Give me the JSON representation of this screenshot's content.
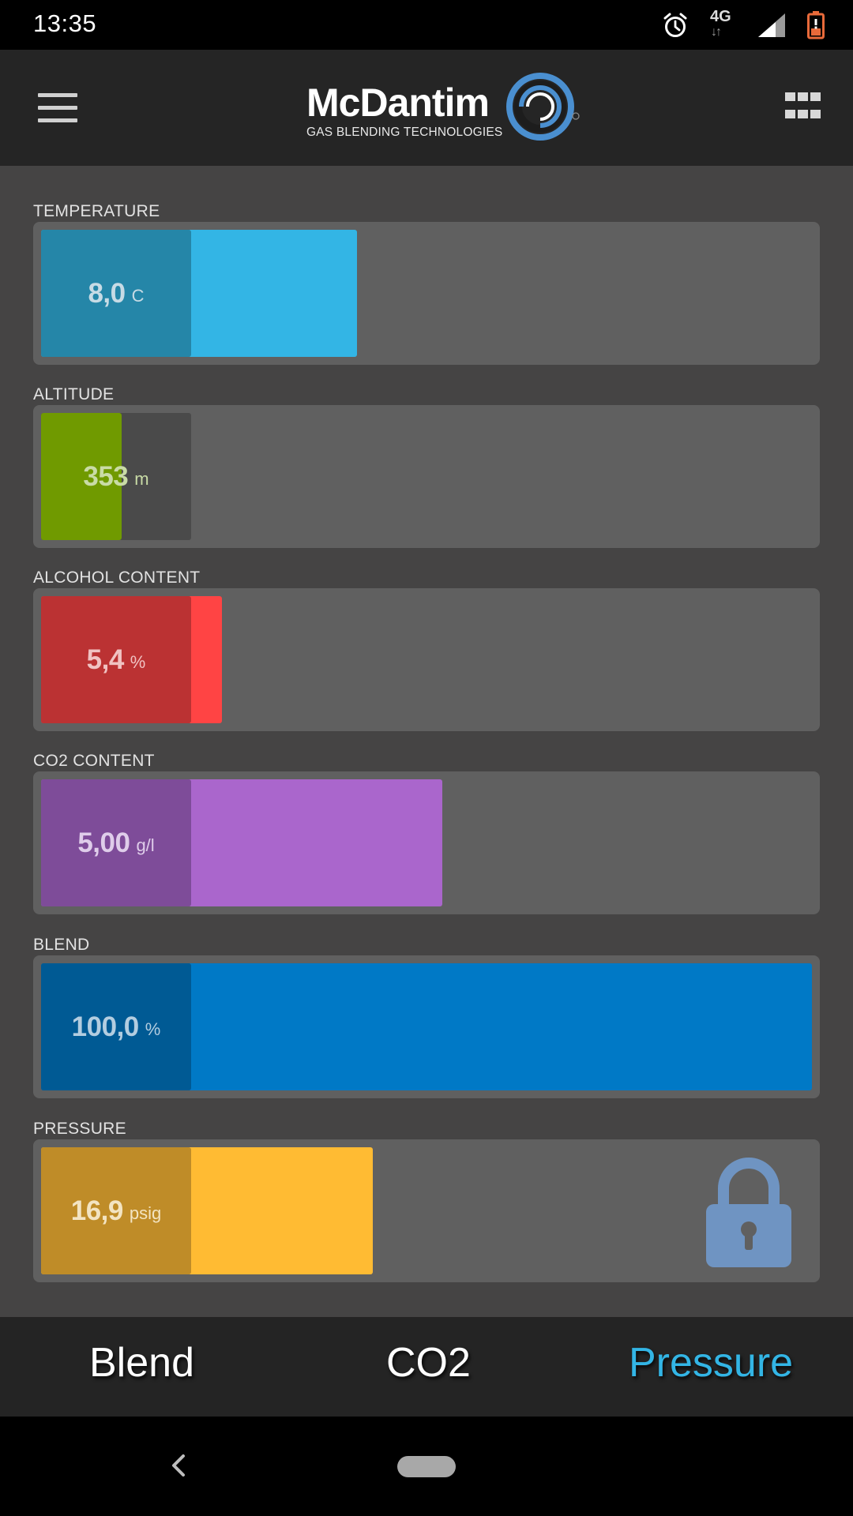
{
  "status_bar": {
    "time": "13:35",
    "network": "4G",
    "icons": [
      "alarm-icon",
      "network-4g-icon",
      "signal-icon",
      "battery-low-icon"
    ]
  },
  "header": {
    "logo_name": "McDantim",
    "logo_subtitle": "GAS BLENDING TECHNOLOGIES",
    "menu_icon": "hamburger-menu-icon",
    "grid_icon": "grid-apps-icon"
  },
  "gauges": [
    {
      "key": "temperature",
      "label": "TEMPERATURE",
      "value": "8,0",
      "unit": "C",
      "level": 0.41,
      "fill_color": "#33b5e5",
      "box_color": "#2586a8",
      "text_color": "#c7dbe5"
    },
    {
      "key": "altitude",
      "label": "ALTITUDE",
      "value": "353",
      "unit": "m",
      "level": 0.105,
      "fill_color": "#709a00",
      "box_color": "#4a4a4a",
      "text_color": "#c9dba6"
    },
    {
      "key": "alcohol",
      "label": "ALCOHOL CONTENT",
      "value": "5,4",
      "unit": "%",
      "level": 0.235,
      "fill_color": "#ff4444",
      "box_color": "#bb3233",
      "text_color": "#f0c2c2"
    },
    {
      "key": "co2",
      "label": "CO2 CONTENT",
      "value": "5,00",
      "unit": "g/l",
      "level": 0.52,
      "fill_color": "#aa66cc",
      "box_color": "#7e4c99",
      "text_color": "#dfcdea"
    },
    {
      "key": "blend",
      "label": "BLEND",
      "value": "100,0",
      "unit": "%",
      "level": 1.0,
      "fill_color": "#0079c6",
      "box_color": "#005a94",
      "text_color": "#b3cde0"
    },
    {
      "key": "pressure",
      "label": "PRESSURE",
      "value": "16,9",
      "unit": "psig",
      "level": 0.43,
      "fill_color": "#ffbb33",
      "box_color": "#bf8c28",
      "text_color": "#f3e4c2",
      "locked": true,
      "lock_icon": "lock-icon",
      "lock_color": "#6f94c2"
    }
  ],
  "tabs": [
    {
      "label": "Blend",
      "active": false
    },
    {
      "label": "CO2",
      "active": false
    },
    {
      "label": "Pressure",
      "active": true
    }
  ],
  "colors": {
    "active_tab": "#33b5e5",
    "inactive_tab": "#ffffff"
  },
  "nav": {
    "icons": [
      "back-icon",
      "home-pill-icon"
    ]
  }
}
